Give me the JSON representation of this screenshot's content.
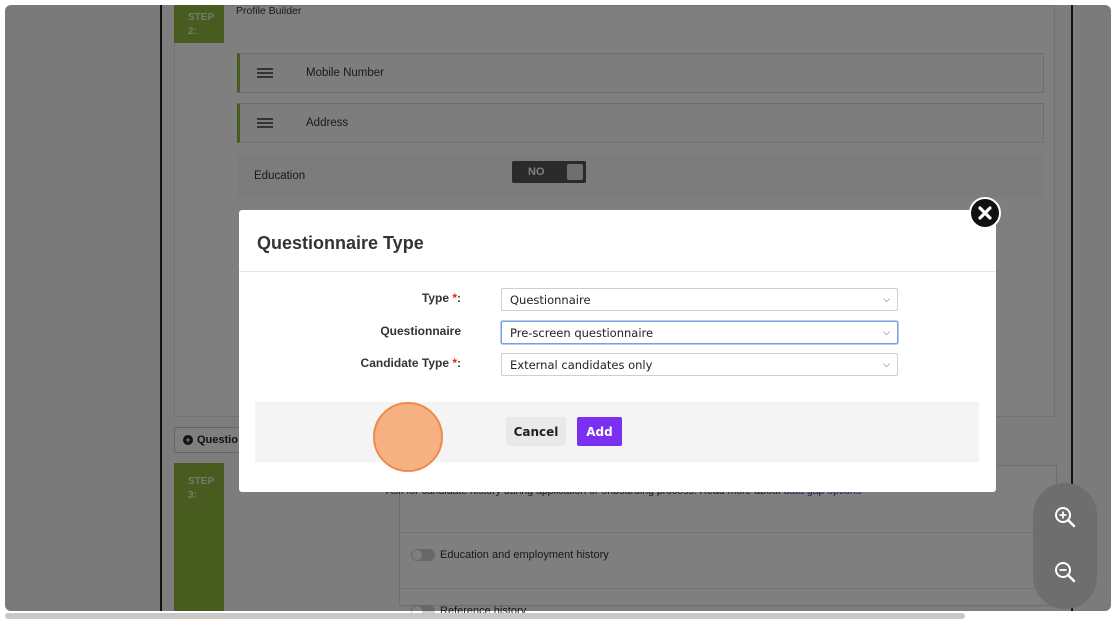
{
  "background": {
    "step2": {
      "badge": "STEP\n2:",
      "title": "Profile Builder"
    },
    "fields": [
      {
        "label": "Mobile Number",
        "icon": "drag-handle-icon"
      },
      {
        "label": "Address",
        "icon": "drag-handle-icon"
      }
    ],
    "education": {
      "label": "Education",
      "toggle": "NO"
    },
    "question_button": {
      "label": "Questio"
    },
    "step3": {
      "badge": "STEP\n3:",
      "description": "Ask for candidate history during application or onboarding process. Read more about ",
      "link": "data gap options",
      "rows": [
        "Education and employment history",
        "Reference history"
      ]
    }
  },
  "modal": {
    "title": "Questionnaire Type",
    "fields": {
      "type": {
        "label": "Type ",
        "required": "*",
        "colon": ":",
        "value": "Questionnaire"
      },
      "questionnaire": {
        "label": "Questionnaire",
        "value": "Pre-screen questionnaire"
      },
      "candidate_type": {
        "label": "Candidate Type ",
        "required": "*",
        "colon": ":",
        "value": "External candidates only"
      }
    },
    "cancel_label": "Cancel",
    "add_label": "Add"
  },
  "colors": {
    "accent": "#7b2ff0",
    "step_green": "#8fb83c",
    "required": "#e02424"
  }
}
